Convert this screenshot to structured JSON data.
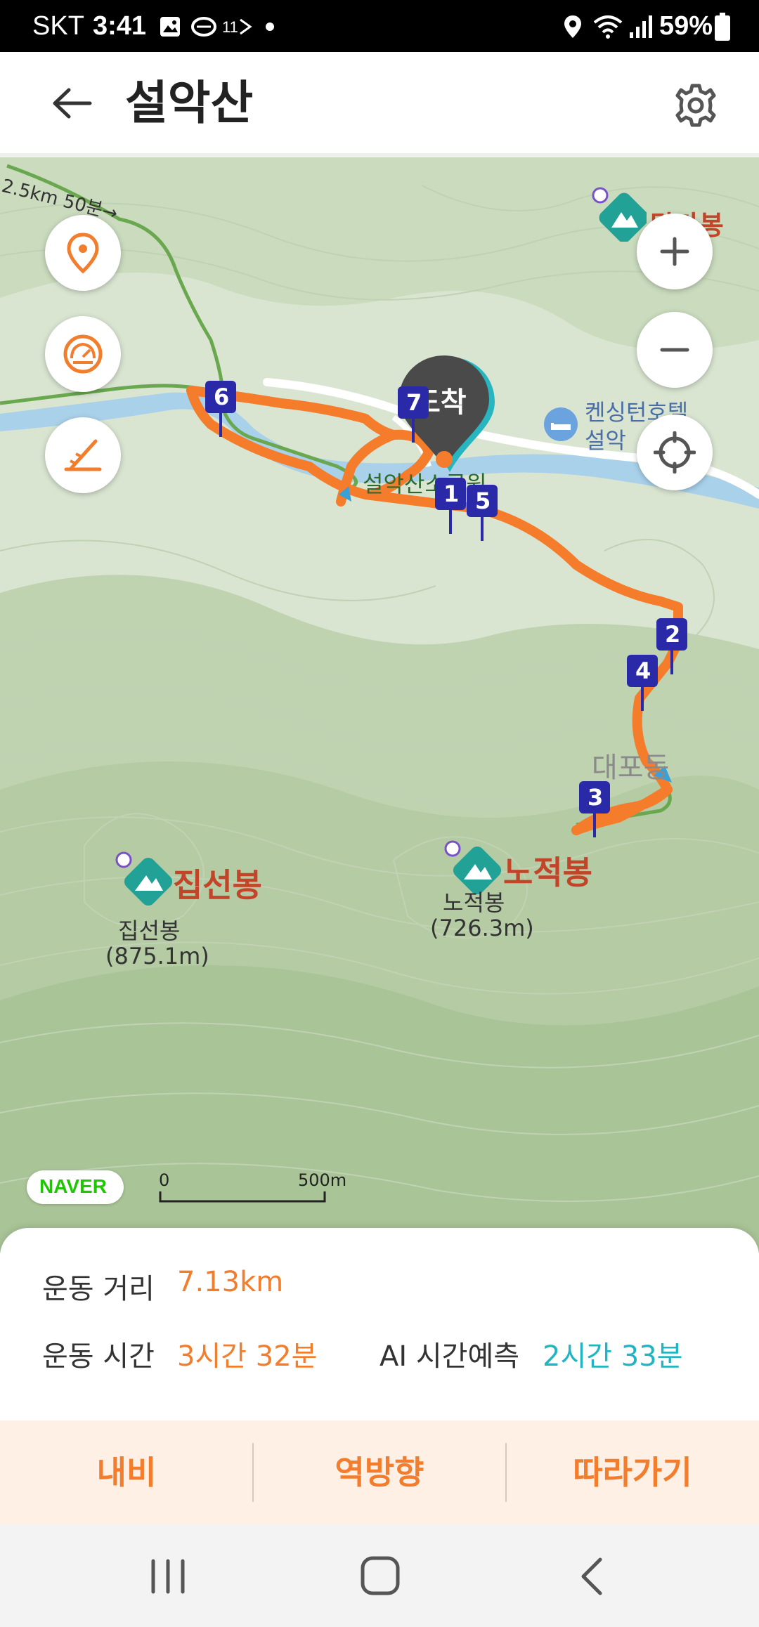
{
  "status_bar": {
    "carrier": "SKT",
    "time": "3:41",
    "battery": "59%",
    "icons": [
      "image-icon",
      "run-icon",
      "11st-icon",
      "dot-icon",
      "location-icon",
      "wifi-icon",
      "signal-icon",
      "battery-icon"
    ]
  },
  "header": {
    "title": "설악산",
    "back_icon": "arrow-left-icon",
    "settings_icon": "gear-icon"
  },
  "map": {
    "trail_hint": "2.5km 50분→",
    "pois": {
      "dalma": "달마봉",
      "hotel_line1": "켄싱턴호텔",
      "hotel_line2": "설악",
      "park": "설악산소공원",
      "daepo": "대포동",
      "jipseon_title": "집선봉",
      "jipseon_name": "집선봉",
      "jipseon_height": "(875.1m)",
      "nojeok_title": "노적봉",
      "nojeok_name": "노적봉",
      "nojeok_height": "(726.3m)"
    },
    "arrival_pin": "도착",
    "markers": [
      "1",
      "2",
      "3",
      "4",
      "5",
      "6",
      "7"
    ],
    "logo": "NAVER",
    "scale": {
      "start": "0",
      "end": "500m"
    },
    "colors": {
      "route": "#f47c2a",
      "marker": "#2a2aa8",
      "river": "#a9d1ea",
      "trail": "#6aa84f"
    },
    "left_buttons": [
      "location-pin-icon",
      "speedometer-icon",
      "slope-icon"
    ],
    "right_buttons": [
      "zoom-in-icon",
      "zoom-out-icon",
      "crosshair-icon"
    ]
  },
  "stats": {
    "distance_label": "운동 거리",
    "distance_value": "7.13km",
    "time_label": "운동 시간",
    "time_value": "3시간 32분",
    "ai_label": "AI 시간예측",
    "ai_value": "2시간 33분",
    "colors": {
      "value": "#f27d2c",
      "ai": "#1fb5c2"
    }
  },
  "actions": {
    "navi": "내비",
    "reverse": "역방향",
    "follow": "따라가기"
  },
  "nav_bar": {
    "icons": [
      "recent-apps-icon",
      "home-icon",
      "back-icon"
    ]
  }
}
